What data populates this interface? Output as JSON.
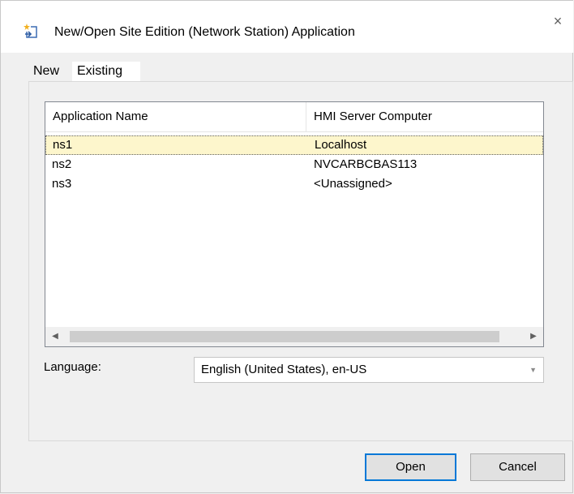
{
  "window": {
    "title": "New/Open Site Edition (Network Station) Application",
    "icon": "new-open-application-icon",
    "close_glyph": "×"
  },
  "tabs": [
    {
      "label": "New",
      "selected": false
    },
    {
      "label": "Existing",
      "selected": true
    }
  ],
  "table": {
    "columns": [
      "Application Name",
      "HMI Server Computer"
    ],
    "rows": [
      {
        "name": "ns1",
        "server": "Localhost",
        "selected": true
      },
      {
        "name": "ns2",
        "server": "NVCARBCBAS113",
        "selected": false
      },
      {
        "name": "ns3",
        "server": "<Unassigned>",
        "selected": false
      }
    ],
    "scroll_left_glyph": "◀",
    "scroll_right_glyph": "▶"
  },
  "language": {
    "label": "Language:",
    "value": "English (United States), en-US",
    "dropdown_glyph": "▼"
  },
  "buttons": {
    "open": "Open",
    "cancel": "Cancel"
  },
  "colors": {
    "selected_row": "#fdf6cc",
    "default_button_border": "#0078d7"
  }
}
